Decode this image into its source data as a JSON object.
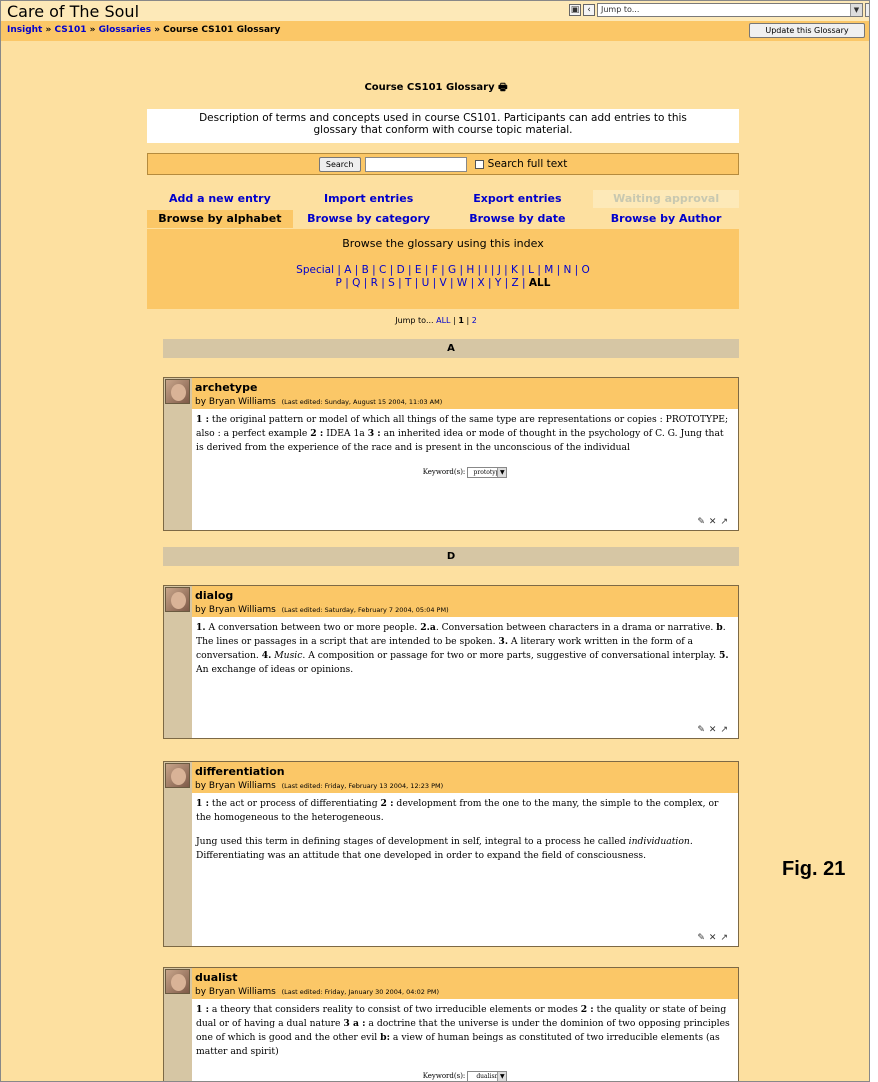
{
  "header": {
    "site_title": "Care of The Soul",
    "jump_placeholder": "Jump to...",
    "update_button": "Update this Glossary"
  },
  "breadcrumb": {
    "items": [
      "Insight",
      "CS101",
      "Glossaries"
    ],
    "separator": "»",
    "current": "Course CS101 Glossary"
  },
  "page": {
    "title": "Course CS101 Glossary",
    "description_line1": "Description of terms and concepts used in course CS101. Participants can add entries to this",
    "description_line2": "glossary that conform with course topic material."
  },
  "search": {
    "button": "Search",
    "fulltext_label": "Search full text"
  },
  "tabs": {
    "row1": [
      "Add a new entry",
      "Import entries",
      "Export entries",
      "Waiting approval"
    ],
    "row2": [
      "Browse by alphabet",
      "Browse by category",
      "Browse by date",
      "Browse by Author"
    ]
  },
  "index": {
    "label": "Browse the glossary using this index",
    "line1": "Special | A | B | C | D | E | F | G | H | I | J | K | L | M | N | O",
    "line2": "P | Q | R | S | T | U | V | W | X | Y | Z | ",
    "current": "ALL"
  },
  "pager": {
    "label": "Jump to...",
    "all": "ALL",
    "sep": "|",
    "page1": "1",
    "page2": "2"
  },
  "sections": [
    "A",
    "D"
  ],
  "entries": [
    {
      "term": "archetype",
      "author": "by Bryan Williams",
      "edited": "(Last edited: Sunday, August 15 2004, 11:03 AM)",
      "keyword_label": "Keyword(s):",
      "keyword": "prototype"
    },
    {
      "term": "dialog",
      "author": "by Bryan Williams",
      "edited": "(Last edited: Saturday, February 7 2004, 05:04 PM)"
    },
    {
      "term": "differentiation",
      "author": "by Bryan Williams",
      "edited": "(Last edited: Friday, February 13 2004, 12:23 PM)"
    },
    {
      "term": "dualist",
      "author": "by Bryan Williams",
      "edited": "(Last edited: Friday, January 30 2004, 04:02 PM)",
      "keyword_label": "Keyword(s):",
      "keyword": "dualism"
    }
  ],
  "definitions": {
    "archetype": {
      "n1": "1 :",
      "t1": " the original pattern or model of which all things of the same type are representations or copies : PROTOTYPE; also : a perfect example ",
      "n2": "2 :",
      "t2": " IDEA 1a ",
      "n3": "3 :",
      "t3": " an inherited idea or mode of thought in the psychology of C. G. Jung that is derived from the experience of the race and is present in the unconscious of the individual"
    },
    "dialog": {
      "n1": "1.",
      "t1": " A conversation between two or more people. ",
      "n2": "2.a",
      "t2": ". Conversation between characters in a drama or narrative. ",
      "n3": "b",
      "t3": ". The lines or passages in a script that are intended to be spoken. ",
      "n4": "3.",
      "t4": " A literary work written in the form of a conversation. ",
      "n5": "4.",
      "t5a": " ",
      "music": "Music",
      "t5b": ". A composition or passage for two or more parts, suggestive of conversational interplay.  ",
      "n6": "5.",
      "t6": " An exchange of ideas or opinions."
    },
    "differentiation": {
      "n1": "1 :",
      "t1": " the act or process of differentiating  ",
      "n2": "2 :",
      "t2": " development from the one to the many, the simple to the complex, or the homogeneous to the heterogeneous.",
      "p2a": "Jung used this term in defining stages of development in self, integral to a process he called ",
      "p2i": "individuation",
      "p2b": ".  Differentiating was an attitude that one developed in order to expand the field of consciousness."
    },
    "dualist": {
      "n1": "1 :",
      "t1": " a theory that considers reality to consist of two irreducible elements or modes ",
      "n2": "2 :",
      "t2": " the quality or state of being dual or of having a dual nature ",
      "n3": "3 a :",
      "t3": " a doctrine that the universe is under the dominion of two opposing principles one of which is good and the other evil ",
      "n4": "b:",
      "t4": " a view of human beings as constituted of two irreducible elements (as matter and spirit)"
    }
  },
  "figure_caption": "Fig. 21",
  "icons": [
    "edit-icon",
    "delete-icon",
    "export-icon",
    "print-icon"
  ]
}
